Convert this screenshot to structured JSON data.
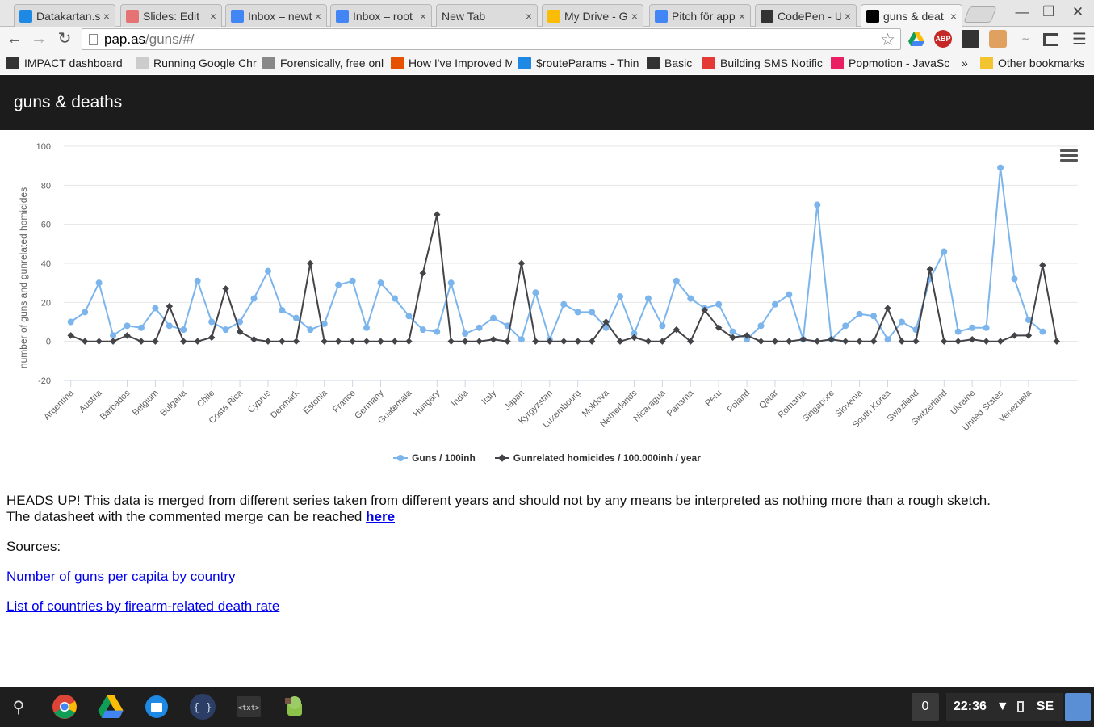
{
  "browser": {
    "tabs": [
      {
        "title": "Datakartan.se",
        "icon": "dropbox-icon",
        "color": "#1e88e5"
      },
      {
        "title": "Slides: Edit",
        "icon": "slides-icon",
        "color": "#e57373"
      },
      {
        "title": "Inbox – newt",
        "icon": "inbox-icon",
        "color": "#4285f4"
      },
      {
        "title": "Inbox – root",
        "icon": "inbox-icon",
        "color": "#4285f4"
      },
      {
        "title": "New Tab",
        "icon": "",
        "color": ""
      },
      {
        "title": "My Drive - G",
        "icon": "drive-icon",
        "color": "#fbbc05"
      },
      {
        "title": "Pitch för app",
        "icon": "docs-icon",
        "color": "#4285f4"
      },
      {
        "title": "CodePen - U",
        "icon": "codepen-icon",
        "color": "#333333"
      },
      {
        "title": "guns & deat",
        "icon": "medium-icon",
        "color": "#000000"
      }
    ],
    "close_glyph": "×",
    "url_host": "pap.as",
    "url_path": "/guns/#/",
    "bookmarks": [
      {
        "label": "IMPACT dashboard",
        "icon": "impact-icon",
        "color": "#333"
      },
      {
        "label": "Running Google Chro",
        "icon": "page-icon",
        "color": "#ccc"
      },
      {
        "label": "Forensically, free onl",
        "icon": "magnifier-icon",
        "color": "#888"
      },
      {
        "label": "How I've Improved M",
        "icon": "star-icon",
        "color": "#e65100"
      },
      {
        "label": "$routeParams - Thin",
        "icon": "smile-icon",
        "color": "#1e88e5"
      },
      {
        "label": "Basic",
        "icon": "codepen-icon",
        "color": "#333"
      },
      {
        "label": "Building SMS Notific",
        "icon": "twilio-icon",
        "color": "#e53935"
      },
      {
        "label": "Popmotion - JavaSc",
        "icon": "popmotion-icon",
        "color": "#e91e63"
      }
    ],
    "bookmarks_overflow": "»",
    "other_bookmarks": "Other bookmarks"
  },
  "page": {
    "title": "guns & deaths",
    "notice_line1": "HEADS UP! This data is merged from different series taken from different years and should not by any means be interpreted as nothing more than a rough sketch.",
    "notice_line2": "The datasheet with the commented merge can be reached ",
    "notice_link": "here",
    "sources_label": "Sources:",
    "source_links": [
      "Number of guns per capita by country",
      "List of countries by firearm-related death rate"
    ]
  },
  "chart_data": {
    "type": "line",
    "ylabel": "number of guns and gunrelated homicides",
    "ylim": [
      -20,
      100
    ],
    "yticks": [
      100,
      80,
      60,
      40,
      20,
      0,
      -20
    ],
    "grid": true,
    "legend": "bottom",
    "x_tick_labels": [
      "Argentina",
      "Austria",
      "Barbados",
      "Belgium",
      "Bulgaria",
      "Chile",
      "Costa Rica",
      "Cyprus",
      "Denmark",
      "Estonia",
      "France",
      "Germany",
      "Guatemala",
      "Hungary",
      "India",
      "Italy",
      "Japan",
      "Kyrgyzstan",
      "Luxembourg",
      "Moldova",
      "Netherlands",
      "Nicaragua",
      "Panama",
      "Peru",
      "Poland",
      "Qatar",
      "Romania",
      "Singapore",
      "Slovenia",
      "South Korea",
      "Swaziland",
      "Switzerland",
      "Ukraine",
      "United States",
      "Venezuela"
    ],
    "n_points": 72,
    "series": [
      {
        "name": "Guns / 100inh",
        "color": "#7cb5ec",
        "marker": "circle",
        "values": [
          10,
          15,
          30,
          3,
          8,
          7,
          17,
          8,
          6,
          31,
          10,
          6,
          10,
          22,
          36,
          16,
          12,
          6,
          9,
          29,
          31,
          7,
          30,
          22,
          13,
          6,
          5,
          30,
          4,
          7,
          12,
          8,
          1,
          25,
          1,
          19,
          15,
          15,
          7,
          23,
          4,
          22,
          8,
          31,
          22,
          17,
          19,
          5,
          1,
          8,
          19,
          24,
          1,
          70,
          1,
          8,
          14,
          13,
          1,
          10,
          6,
          32,
          46,
          5,
          7,
          7,
          89,
          32,
          11,
          5
        ]
      },
      {
        "name": "Gunrelated homicides / 100.000inh / year",
        "color": "#434348",
        "marker": "diamond",
        "values": [
          3,
          0,
          0,
          0,
          3,
          0,
          0,
          18,
          0,
          0,
          2,
          27,
          5,
          1,
          0,
          0,
          0,
          40,
          0,
          0,
          0,
          0,
          0,
          0,
          0,
          35,
          65,
          0,
          0,
          0,
          1,
          0,
          40,
          0,
          0,
          0,
          0,
          0,
          10,
          0,
          2,
          0,
          0,
          6,
          0,
          16,
          7,
          2,
          3,
          0,
          0,
          0,
          1,
          0,
          1,
          0,
          0,
          0,
          17,
          0,
          0,
          37,
          0,
          0,
          1,
          0,
          0,
          3,
          3,
          39,
          0
        ]
      }
    ]
  },
  "shelf": {
    "notification_count": "0",
    "time": "22:36",
    "locale": "SE"
  }
}
